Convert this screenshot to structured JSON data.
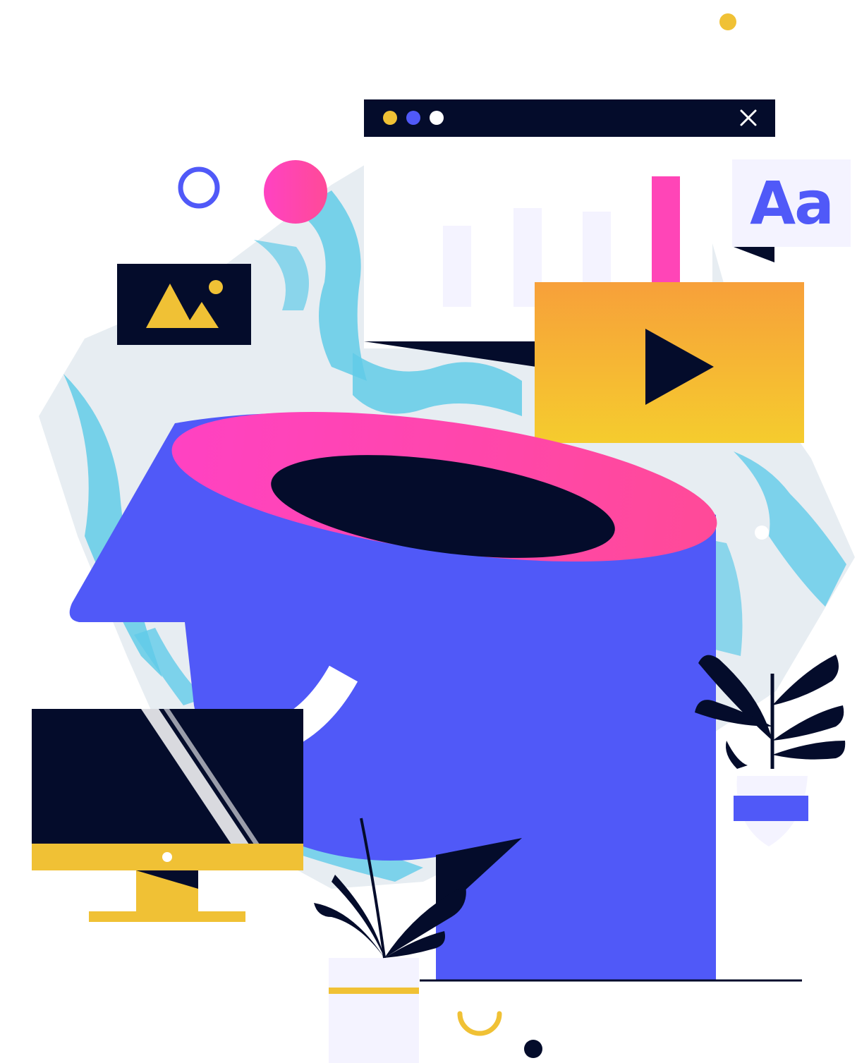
{
  "illustration": {
    "typography_card": {
      "text": "Aa"
    },
    "browser_window": {
      "dots": [
        "#f0c135",
        "#5059f8",
        "#ffffff"
      ],
      "close_icon": "close-icon"
    },
    "icons": [
      "image-icon",
      "play-icon",
      "close-icon"
    ],
    "colors": {
      "navy": "#040c2b",
      "blue": "#5059f8",
      "pink": "#ff45b7",
      "orange": "#f7a53b",
      "yellow": "#f0c135",
      "cyan": "#62cbe8",
      "lavender": "#f4f3ff"
    }
  }
}
